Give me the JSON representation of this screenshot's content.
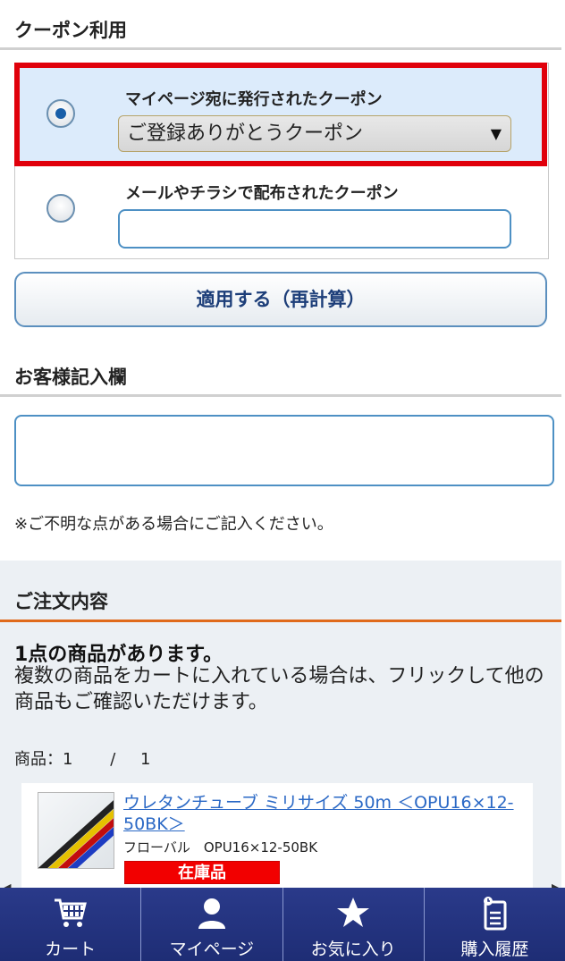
{
  "coupon": {
    "title": "クーポン利用",
    "option1_label": "マイページ宛に発行されたクーポン",
    "option1_selected_value": "ご登録ありがとうクーポン",
    "option2_label": "メールやチラシで配布されたクーポン",
    "option2_input_value": "",
    "apply_button": "適用する（再計算）"
  },
  "customer_note": {
    "title": "お客様記入欄",
    "input_value": "",
    "note": "※ご不明な点がある場合にご記入ください。"
  },
  "order": {
    "title": "ご注文内容",
    "count_text": "1点の商品があります。",
    "description": "複数の商品をカートに入れている場合は、フリックして他の商品もご確認いただけます。",
    "pager_label": "商品：1",
    "pager_sep": "/",
    "pager_total": "1",
    "item": {
      "name": "ウレタンチューブ ミリサイズ 50m ＜OPU16×12-50BK＞",
      "maker": "フローバル　OPU16×12-50BK",
      "stock": "在庫品"
    }
  },
  "nav": {
    "items": [
      {
        "label": "カート",
        "icon": "cart-icon"
      },
      {
        "label": "マイページ",
        "icon": "person-icon"
      },
      {
        "label": "お気に入り",
        "icon": "star-icon"
      },
      {
        "label": "購入履歴",
        "icon": "history-icon"
      }
    ]
  },
  "colors": {
    "accent_blue": "#1d3e79",
    "highlight_red": "#e0000b",
    "selected_bg": "#dcebfb",
    "nav_bg": "#24347f",
    "order_divider": "#e06a1b",
    "stock_red": "#f20000"
  }
}
